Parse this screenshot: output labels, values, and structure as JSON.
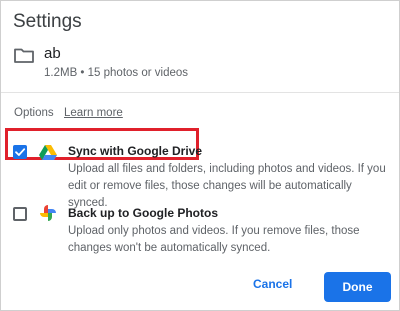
{
  "dialog": {
    "title": "Settings"
  },
  "folder": {
    "icon": "folder-icon",
    "name": "ab",
    "meta": "1.2MB • 15 photos or videos"
  },
  "options": {
    "label": "Options",
    "learn_more": "Learn more",
    "items": [
      {
        "icon": "google-drive-icon",
        "title": "Sync with Google Drive",
        "description": "Upload all files and folders, including photos and videos. If you edit or remove files, those changes will be automatically synced.",
        "checked": true
      },
      {
        "icon": "google-photos-icon",
        "title": "Back up to Google Photos",
        "description": "Upload only photos and videos. If you remove files, those changes won't be automatically synced.",
        "checked": false
      }
    ]
  },
  "buttons": {
    "cancel": "Cancel",
    "done": "Done"
  },
  "colors": {
    "accent": "#1a73e8",
    "highlight_box": "#e0202b"
  }
}
